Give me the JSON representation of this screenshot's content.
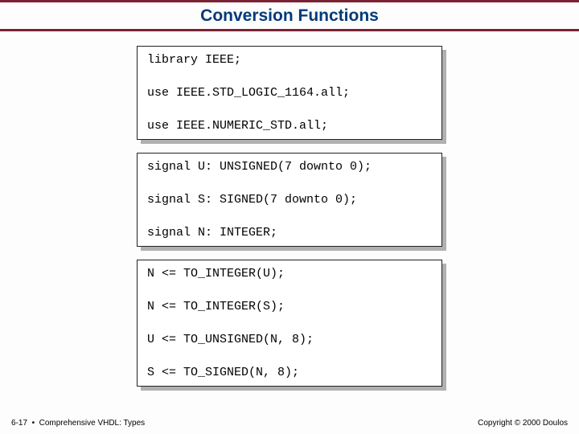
{
  "header": {
    "title": "Conversion Functions"
  },
  "box1": {
    "lines": [
      "library IEEE;",
      "use IEEE.STD_LOGIC_1164.all;",
      "use IEEE.NUMERIC_STD.all;"
    ]
  },
  "box2": {
    "lines": [
      "signal U: UNSIGNED(7 downto 0);",
      "signal S: SIGNED(7 downto 0);",
      "signal N: INTEGER;"
    ]
  },
  "box3": {
    "lines": [
      "N <= TO_INTEGER(U);",
      "N <= TO_INTEGER(S);",
      "U <= TO_UNSIGNED(N, 8);",
      "S <= TO_SIGNED(N, 8);"
    ]
  },
  "footer": {
    "left": "6-17  •  Comprehensive VHDL: Types",
    "right": "Copyright © 2000 Doulos"
  }
}
